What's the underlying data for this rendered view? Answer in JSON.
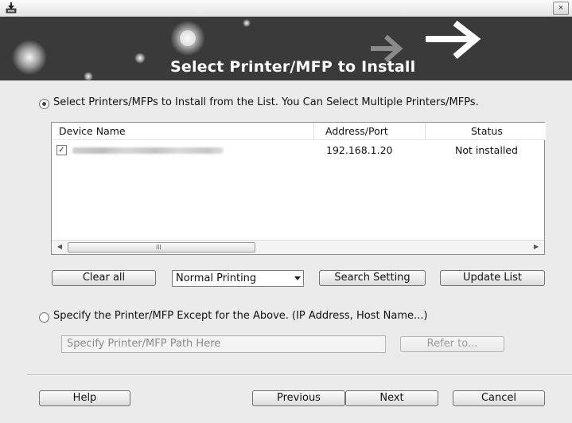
{
  "window": {
    "close_glyph": "×"
  },
  "banner": {
    "title": "Select Printer/MFP to Install"
  },
  "option_list": {
    "label": "Select Printers/MFPs to Install from the List. You Can Select Multiple Printers/MFPs.",
    "checked": true
  },
  "device_table": {
    "columns": [
      "Device Name",
      "Address/Port",
      "Status"
    ],
    "rows": [
      {
        "checked": true,
        "device_name": "",
        "address_port": "192.168.1.20",
        "status": "Not installed"
      }
    ],
    "scroll_left": "◀",
    "scroll_right": "▶",
    "scroll_grip": "III"
  },
  "list_buttons": {
    "clear_all": "Clear all",
    "printing_mode": "Normal Printing",
    "search_setting": "Search Setting",
    "update_list": "Update List"
  },
  "option_path": {
    "label": "Specify the Printer/MFP Except for the Above. (IP Address, Host Name...)",
    "checked": false,
    "placeholder": "Specify Printer/MFP Path Here",
    "refer_button": "Refer to..."
  },
  "footer": {
    "help": "Help",
    "previous": "Previous",
    "next": "Next",
    "cancel": "Cancel"
  },
  "colors": {
    "banner": "#3a3a3a",
    "dialog": "#ebebeb"
  }
}
